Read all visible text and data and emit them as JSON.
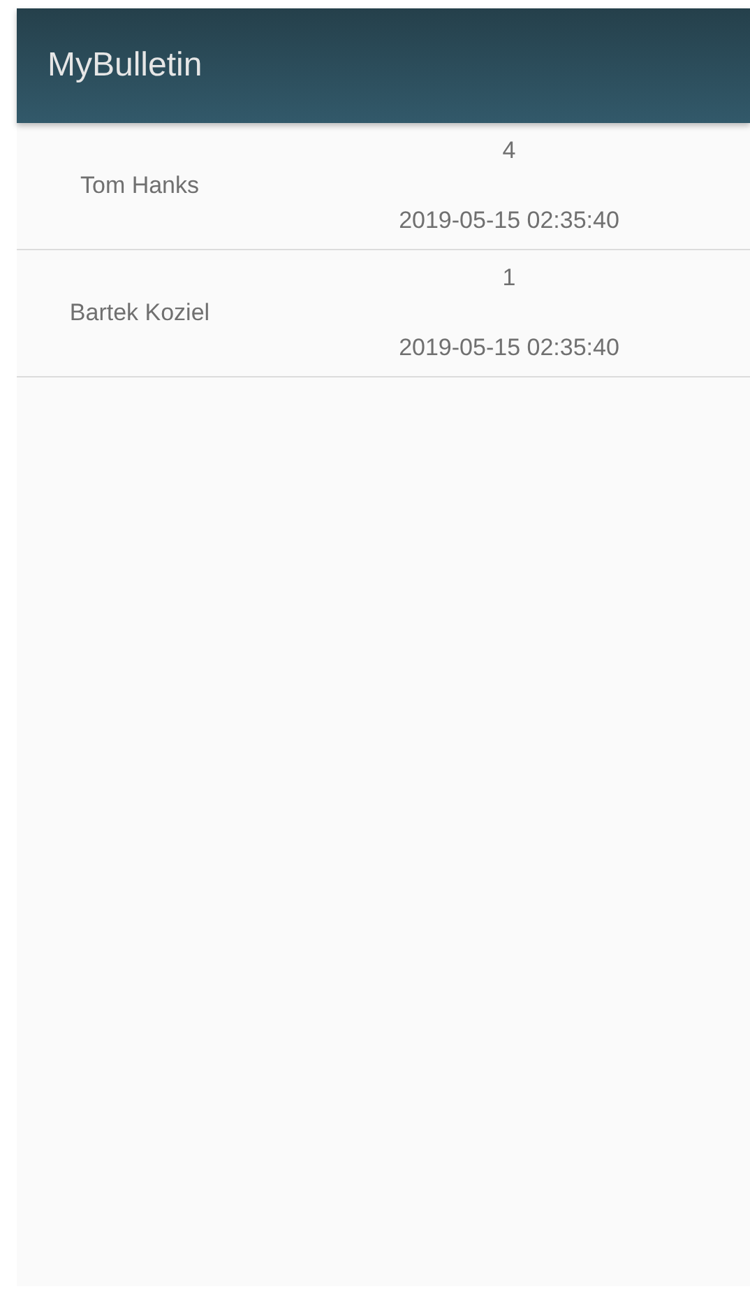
{
  "app_bar": {
    "title": "MyBulletin"
  },
  "rows": [
    {
      "name": "Tom Hanks",
      "count": "4",
      "timestamp": "2019-05-15 02:35:40"
    },
    {
      "name": "Bartek Koziel",
      "count": "1",
      "timestamp": "2019-05-15 02:35:40"
    }
  ]
}
